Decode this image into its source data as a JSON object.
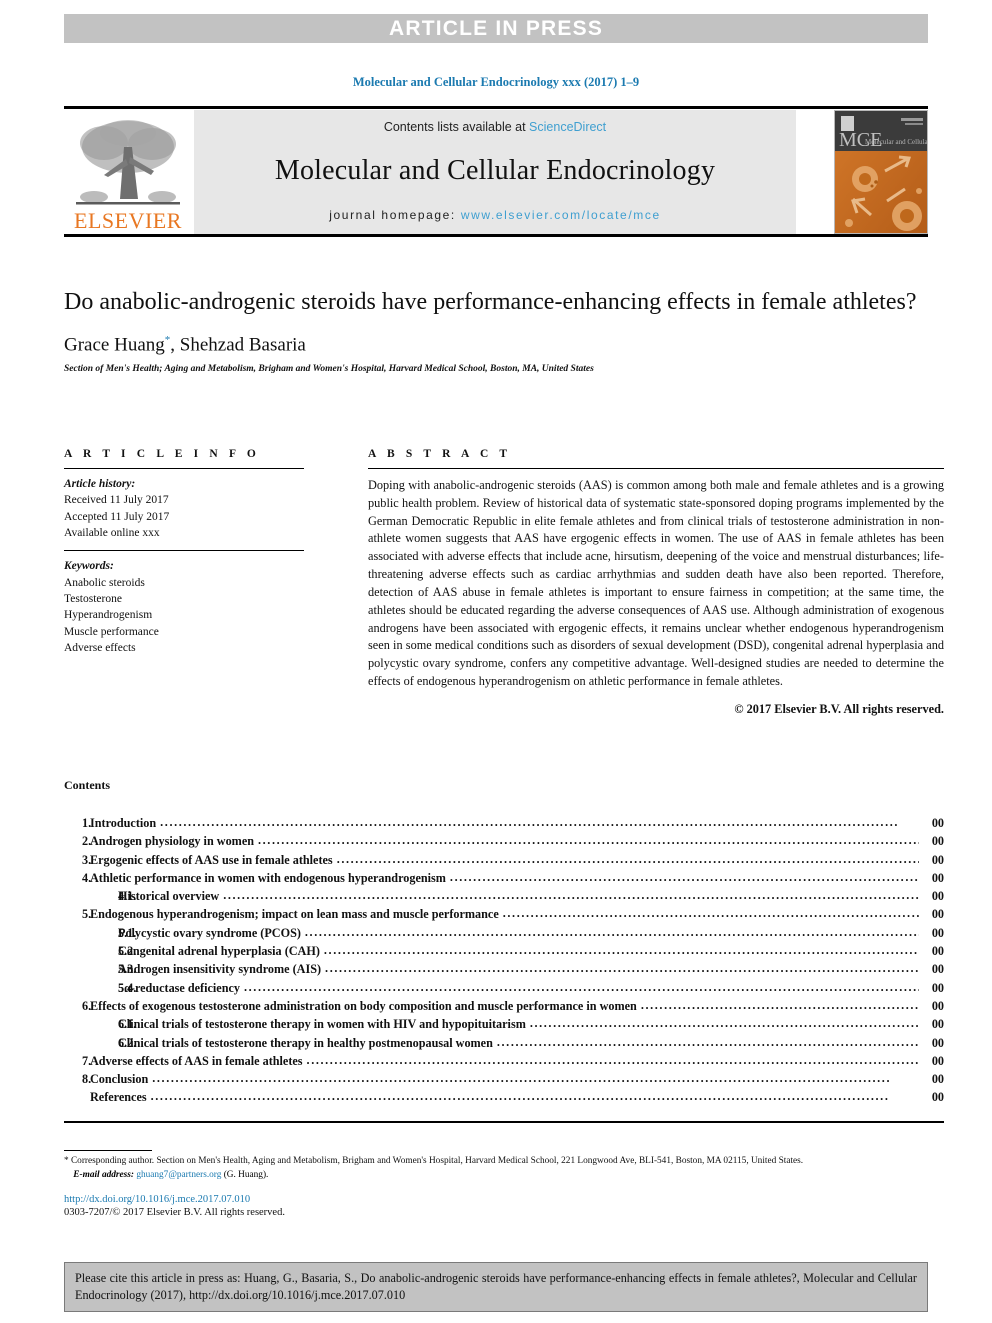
{
  "banner": {
    "text": "ARTICLE IN PRESS",
    "bg_color": "#c2c2c2",
    "text_color": "#ffffff"
  },
  "journal_ref": "Molecular and Cellular Endocrinology xxx (2017) 1–9",
  "masthead": {
    "publisher": "ELSEVIER",
    "contents_prefix": "Contents lists available at ",
    "contents_link": "ScienceDirect",
    "journal_title": "Molecular and Cellular Endocrinology",
    "homepage_label": "journal homepage: ",
    "homepage_url": "www.elsevier.com/locate/mce",
    "cover_abbrev": "MCE",
    "cover_subtitle": "Molecular and Cellular Endocrinology",
    "link_color": "#3f9fd0",
    "brand_color": "#e87722"
  },
  "article": {
    "title": "Do anabolic-androgenic steroids have performance-enhancing effects in female athletes?",
    "authors": "Grace Huang",
    "corresponding_marker": "*",
    "authors_rest": ", Shehzad Basaria",
    "affiliation": "Section of Men's Health; Aging and Metabolism, Brigham and Women's Hospital, Harvard Medical School, Boston, MA, United States"
  },
  "article_info": {
    "heading": "A R T I C L E   I N F O",
    "history_label": "Article history:",
    "history": [
      "Received 11 July 2017",
      "Accepted 11 July 2017",
      "Available online xxx"
    ],
    "keywords_label": "Keywords:",
    "keywords": [
      "Anabolic steroids",
      "Testosterone",
      "Hyperandrogenism",
      "Muscle performance",
      "Adverse effects"
    ]
  },
  "abstract": {
    "heading": "A B S T R A C T",
    "body": "Doping with anabolic-androgenic steroids (AAS) is common among both male and female athletes and is a growing public health problem. Review of historical data of systematic state-sponsored doping programs implemented by the German Democratic Republic in elite female athletes and from clinical trials of testosterone administration in non-athlete women suggests that AAS have ergogenic effects in women. The use of AAS in female athletes has been associated with adverse effects that include acne, hirsutism, deepening of the voice and menstrual disturbances; life-threatening adverse effects such as cardiac arrhythmias and sudden death have also been reported. Therefore, detection of AAS abuse in female athletes is important to ensure fairness in competition; at the same time, the athletes should be educated regarding the adverse consequences of AAS use. Although administration of exogenous androgens have been associated with ergogenic effects, it remains unclear whether endogenous hyperandrogenism seen in some medical conditions such as disorders of sexual development (DSD), congenital adrenal hyperplasia and polycystic ovary syndrome, confers any competitive advantage. Well-designed studies are needed to determine the effects of endogenous hyperandrogenism on athletic performance in female athletes.",
    "copyright": "© 2017 Elsevier B.V. All rights reserved."
  },
  "contents": {
    "heading": "Contents",
    "entries": [
      {
        "num": "1.",
        "label": "Introduction",
        "page": "00",
        "sub": false
      },
      {
        "num": "2.",
        "label": "Androgen physiology in women",
        "page": "00",
        "sub": false
      },
      {
        "num": "3.",
        "label": "Ergogenic effects of AAS use in female athletes",
        "page": "00",
        "sub": false
      },
      {
        "num": "4.",
        "label": "Athletic performance in women with endogenous hyperandrogenism",
        "page": "00",
        "sub": false
      },
      {
        "num": "4.1.",
        "label": "Historical overview",
        "page": "00",
        "sub": true
      },
      {
        "num": "5.",
        "label": "Endogenous hyperandrogenism; impact on lean mass and muscle performance",
        "page": "00",
        "sub": false
      },
      {
        "num": "5.1.",
        "label": "Polycystic ovary syndrome (PCOS)",
        "page": "00",
        "sub": true
      },
      {
        "num": "5.2.",
        "label": "Congenital adrenal hyperplasia (CAH)",
        "page": "00",
        "sub": true
      },
      {
        "num": "5.3.",
        "label": "Androgen insensitivity syndrome (AIS)",
        "page": "00",
        "sub": true
      },
      {
        "num": "5.4.",
        "label": "5α-reductase deficiency",
        "page": "00",
        "sub": true
      },
      {
        "num": "6.",
        "label": "Effects of exogenous testosterone administration on body composition and muscle performance in women",
        "page": "00",
        "sub": false
      },
      {
        "num": "6.1.",
        "label": "Clinical trials of testosterone therapy in women with HIV and hypopituitarism",
        "page": "00",
        "sub": true
      },
      {
        "num": "6.2.",
        "label": "Clinical trials of testosterone therapy in healthy postmenopausal women",
        "page": "00",
        "sub": true
      },
      {
        "num": "7.",
        "label": "Adverse effects of AAS in female athletes",
        "page": "00",
        "sub": false
      },
      {
        "num": "8.",
        "label": "Conclusion",
        "page": "00",
        "sub": false
      },
      {
        "num": "",
        "label": "References",
        "page": "00",
        "sub": false
      }
    ]
  },
  "footnotes": {
    "corresponding": "* Corresponding author. Section on Men's Health, Aging and Metabolism, Brigham and Women's Hospital, Harvard Medical School, 221 Longwood Ave, BLI-541, Boston, MA 02115, United States.",
    "email_label": "E-mail address: ",
    "email": "ghuang7@partners.org",
    "email_suffix": " (G. Huang).",
    "doi": "http://dx.doi.org/10.1016/j.mce.2017.07.010",
    "issn": "0303-7207/© 2017 Elsevier B.V. All rights reserved."
  },
  "cite_box": {
    "text": "Please cite this article in press as: Huang, G., Basaria, S., Do anabolic-androgenic steroids have performance-enhancing effects in female athletes?, Molecular and Cellular Endocrinology (2017), http://dx.doi.org/10.1016/j.mce.2017.07.010",
    "bg_color": "#c2c2c2"
  }
}
